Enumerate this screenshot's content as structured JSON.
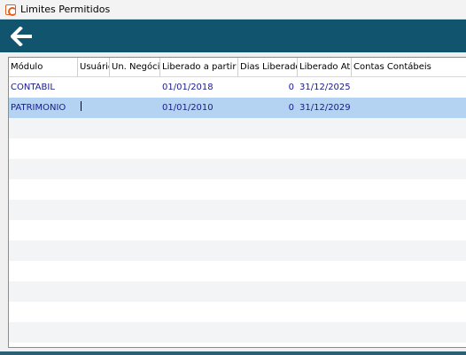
{
  "window": {
    "title": "Limites Permitidos"
  },
  "toolbar": {
    "back_icon": "arrow-left-icon"
  },
  "table": {
    "columns": [
      "Módulo",
      "Usuário",
      "Un. Negócio",
      "Liberado a partir de",
      "Dias Liberados",
      "Liberado Até",
      "Contas Contábeis"
    ],
    "rows": [
      {
        "modulo": "CONTABIL",
        "usuario": "",
        "un_negocio": "",
        "liberado_a_partir": "01/01/2018",
        "dias_liberados": "0",
        "liberado_ate": "31/12/2025",
        "contas_contabeis": ""
      },
      {
        "modulo": "PATRIMONIO",
        "usuario": "",
        "un_negocio": "",
        "liberado_a_partir": "01/01/2010",
        "dias_liberados": "0",
        "liberado_ate": "31/12/2029",
        "contas_contabeis": ""
      }
    ],
    "selected_row": 1
  },
  "colors": {
    "toolbar_bg": "#11546d",
    "selected_row": "#b4d3f2",
    "cell_text": "#1a1a8c",
    "app_icon": "#e35e1e"
  }
}
